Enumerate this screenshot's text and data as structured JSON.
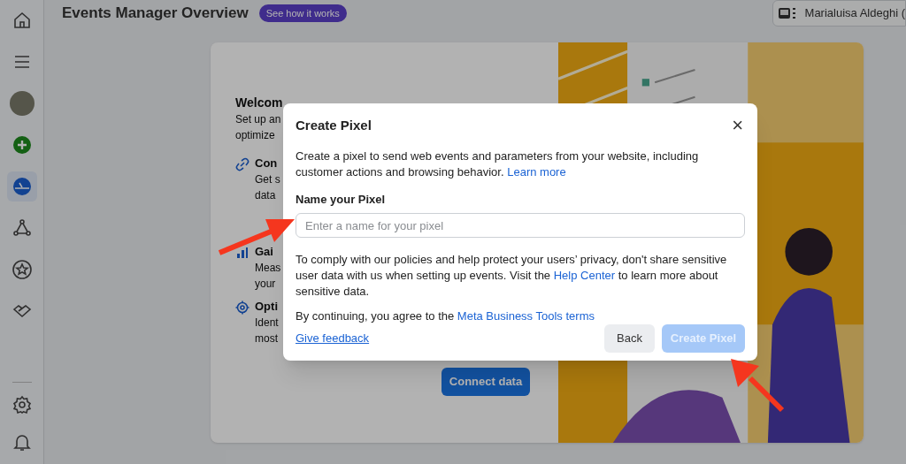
{
  "sidebar": {
    "items": [
      {
        "selected": false
      },
      {
        "selected": false
      },
      {
        "selected": false
      },
      {
        "selected": false
      },
      {
        "selected": true
      },
      {
        "selected": false
      },
      {
        "selected": false
      },
      {
        "selected": false
      }
    ],
    "bottom_items": [
      {
        "selected": false
      },
      {
        "selected": false
      }
    ]
  },
  "header": {
    "title": "Events Manager Overview",
    "badge": "See how it works",
    "account": "Marialuisa Aldeghi ("
  },
  "welcome_card": {
    "title": "Welcom",
    "subtitle_lines": [
      "Set up an",
      "optimize"
    ],
    "features": [
      {
        "kind": "link",
        "title": "Con",
        "lines": [
          "Get s",
          "data"
        ]
      },
      {
        "kind": "chart",
        "title": "Gai",
        "lines": [
          "Meas",
          "your"
        ]
      },
      {
        "kind": "target",
        "title": "Opti",
        "lines": [
          "Ident",
          "most"
        ]
      }
    ],
    "button": "Connect data"
  },
  "dialog": {
    "title": "Create Pixel",
    "close": "×",
    "intro": "Create a pixel to send web events and parameters from your website, including customer actions and browsing behavior.",
    "intro_link": "Learn more",
    "field_label": "Name your Pixel",
    "placeholder": "Enter a name for your pixel",
    "privacy_before": "To comply with our policies and help protect your users’ privacy, don't share sensitive user data with us when setting up events. Visit the",
    "privacy_link": "Help Center",
    "privacy_after": "to learn more about sensitive data.",
    "terms_before": "By continuing, you agree to the",
    "terms_link": "Meta Business Tools terms",
    "feedback": "Give feedback",
    "back": "Back",
    "create": {
      "label": "Create Pixel",
      "disabled": true
    }
  }
}
